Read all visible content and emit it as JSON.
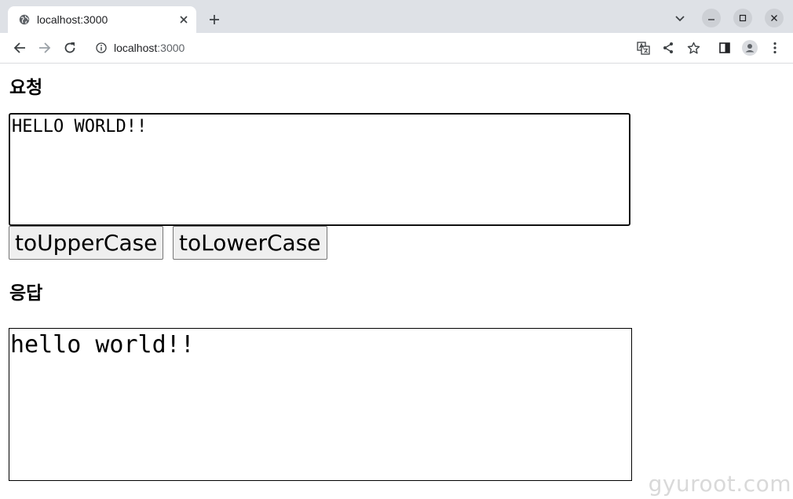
{
  "browser": {
    "tab_title": "localhost:3000",
    "url_host": "localhost",
    "url_port": ":3000"
  },
  "page": {
    "request_heading": "요청",
    "request_text": "HELLO WORLD!!",
    "to_upper_label": "toUpperCase",
    "to_lower_label": "toLowerCase",
    "response_heading": "응답",
    "response_text": "hello world!!"
  },
  "watermark": "gyuroot.com",
  "icons": {
    "tab_favicon": "globe-icon",
    "tab_close": "close-icon",
    "new_tab": "plus-icon",
    "tab_search": "chevron-down-icon",
    "minimize": "minimize-icon",
    "maximize": "maximize-icon",
    "close_window": "close-icon",
    "back": "arrow-left-icon",
    "forward": "arrow-right-icon",
    "reload": "reload-icon",
    "site_info": "info-icon",
    "translate": "translate-icon",
    "share": "share-icon",
    "bookmark": "star-icon",
    "side_panel": "side-panel-icon",
    "profile": "profile-icon",
    "menu": "more-vertical-icon"
  },
  "colors": {
    "tabbar_bg": "#dee1e6",
    "button_bg": "#efefef",
    "button_border": "#767676",
    "watermark": "#d9d9d9"
  }
}
